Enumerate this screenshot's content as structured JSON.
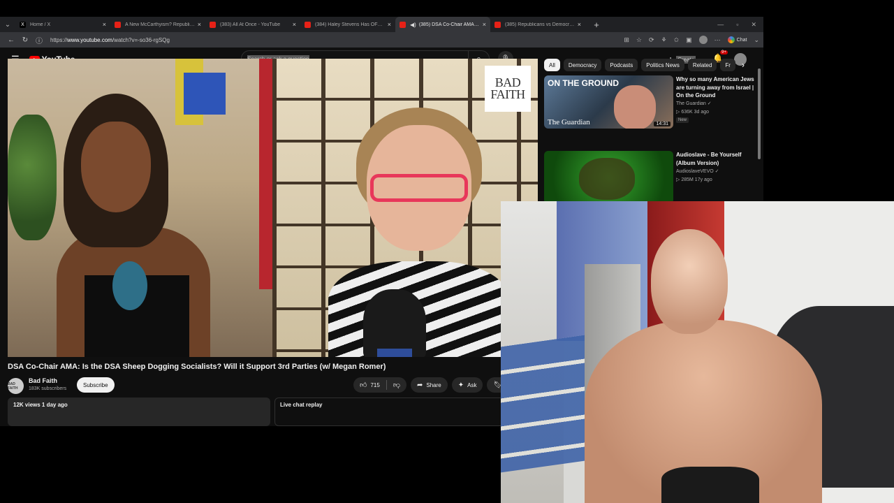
{
  "browser": {
    "tabs": [
      {
        "label": "Home / X",
        "icon": "x-logo-icon",
        "active": false
      },
      {
        "label": "A New McCarthyism? Republicans",
        "icon": "youtube-icon",
        "active": false
      },
      {
        "label": "(383) All At Once - YouTube",
        "icon": "youtube-icon",
        "active": false
      },
      {
        "label": "(384) Haley Stevens Has OFFICIAL",
        "icon": "youtube-icon",
        "active": false
      },
      {
        "label": "(385) DSA Co-Chair AMA: Is th",
        "icon": "youtube-icon",
        "active": true
      },
      {
        "label": "(385) Republicans vs Democrats C",
        "icon": "youtube-icon",
        "active": false
      }
    ],
    "url_prefix": "https://",
    "url_host": "www.youtube.com",
    "url_path": "/watch?v=-so36-rgSQg",
    "chat_label": "Chat"
  },
  "youtube": {
    "logo_text": "YouTube",
    "search_placeholder": "Search or ask a question",
    "create_label": "Create",
    "notification_count": "9+"
  },
  "video": {
    "overlay_logo_line1": "BAD",
    "overlay_logo_line2": "FAITH",
    "title": "DSA Co-Chair AMA: Is the DSA Sheep Dogging Socialists? Will it Support 3rd Parties (w/ Megan Romer)",
    "channel_name": "Bad Faith",
    "channel_avatar_text": "BAD FAITH",
    "subscribers": "183K subscribers",
    "subscribe_label": "Subscribe",
    "likes": "715",
    "share_label": "Share",
    "ask_label": "Ask",
    "views_date": "12K views  1 day ago",
    "chat_replay_label": "Live chat replay"
  },
  "chips": [
    "All",
    "Democracy",
    "Podcasts",
    "Politics News",
    "Related",
    "Fr"
  ],
  "recommendations": [
    {
      "title": "Why so many American Jews are turning away from Israel | On the Ground",
      "channel": "The Guardian",
      "meta": "636K  3d ago",
      "badge": "New",
      "duration": "14:31",
      "thumb_text_top": "ON THE GROUND",
      "thumb_text_bottom": "The Guardian"
    },
    {
      "title": "Audioslave - Be Yourself (Album Version)",
      "channel": "AudioslaveVEVO",
      "meta": "285M  17y ago"
    }
  ],
  "colors": {
    "youtube_red": "#ff0000",
    "background": "#0f0f0f",
    "chip_active": "#f1f1f1"
  }
}
